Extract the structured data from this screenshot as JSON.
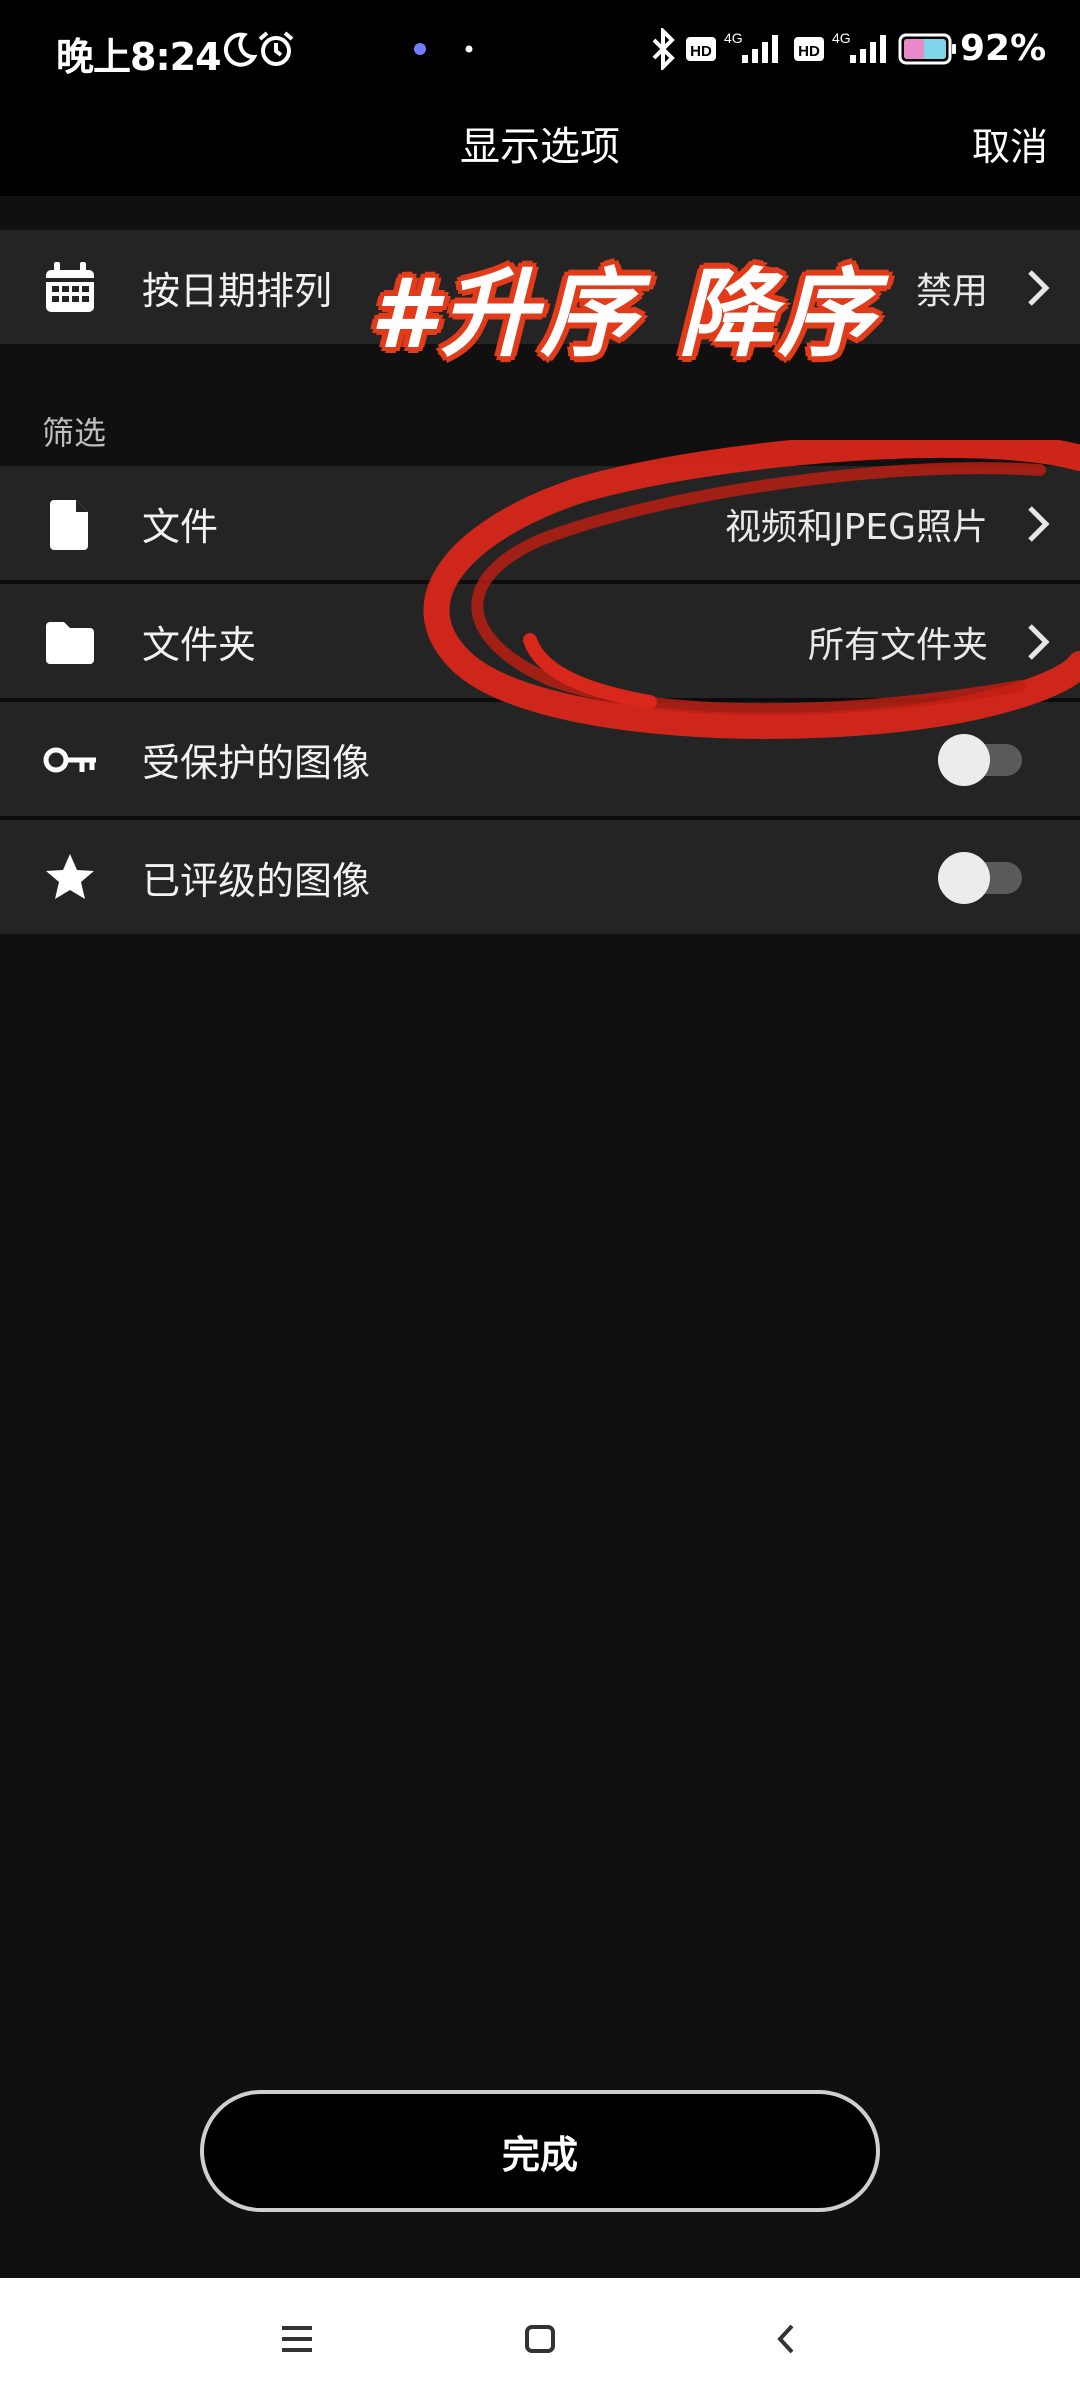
{
  "status_bar": {
    "time": "晚上8:24",
    "battery_percent": "92%",
    "signal_labels": [
      "HD",
      "4G",
      "HD",
      "4G"
    ]
  },
  "header": {
    "title": "显示选项",
    "cancel_label": "取消"
  },
  "sort_row": {
    "label": "按日期排列",
    "value": "禁用",
    "icon": "calendar-icon"
  },
  "overlay": {
    "text": "#升序 降序",
    "color": "#e23b1a"
  },
  "filter_section": {
    "title": "筛选",
    "rows": [
      {
        "label": "文件",
        "value": "视频和JPEG照片",
        "icon": "file-icon"
      },
      {
        "label": "文件夹",
        "value": "所有文件夹",
        "icon": "folder-icon"
      }
    ],
    "toggles": [
      {
        "label": "受保护的图像",
        "icon": "key-icon",
        "on": false
      },
      {
        "label": "已评级的图像",
        "icon": "star-icon",
        "on": false
      }
    ]
  },
  "done_label": "完成",
  "nav_bar": {
    "items": [
      "menu-icon",
      "home-icon",
      "back-icon"
    ]
  }
}
